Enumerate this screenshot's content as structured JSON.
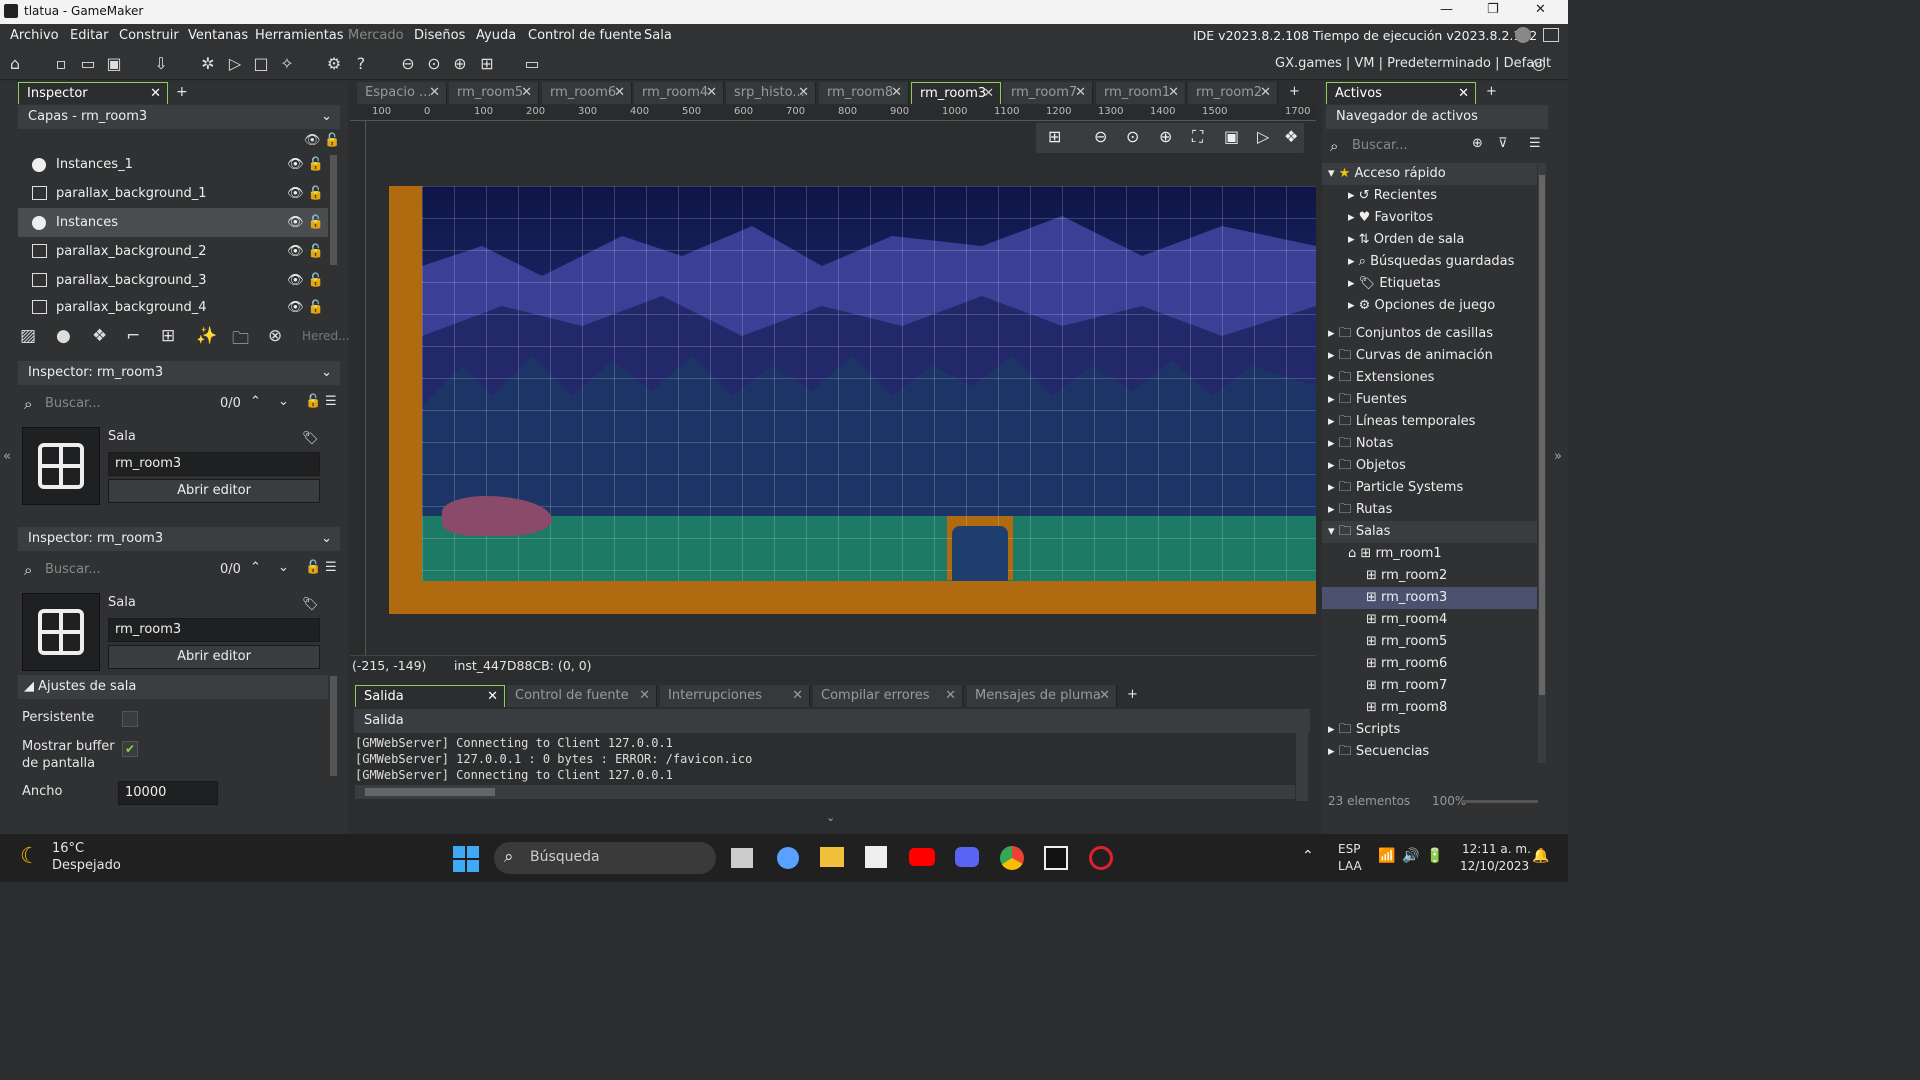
{
  "window": {
    "title": "tlatua - GameMaker",
    "minimize": "—",
    "maximize": "❐",
    "close": "✕"
  },
  "menu": [
    "Archivo",
    "Editar",
    "Construir",
    "Ventanas",
    "Herramientas",
    "Mercado",
    "Diseños",
    "Ayuda",
    "Control de fuente",
    "Sala"
  ],
  "ide_version": "IDE v2023.8.2.108 Tiempo de ejecución v2023.8.2.152",
  "target": "GX.games | VM | Predeterminado | Default",
  "left": {
    "tab": "Inspector",
    "layers_header": "Capas - rm_room3",
    "layers": [
      "Instances_1",
      "parallax_background_1",
      "Instances",
      "parallax_background_2",
      "parallax_background_3",
      "parallax_background_4"
    ],
    "selected_layer": "Instances",
    "inherit_placeholder": "Hered...",
    "inspector1": {
      "header": "Inspector: rm_room3",
      "search": "Buscar...",
      "count": "0/0",
      "kind": "Sala",
      "name": "rm_room3",
      "open": "Abrir editor"
    },
    "inspector2": {
      "header": "Inspector: rm_room3",
      "search": "Buscar...",
      "count": "0/0",
      "kind": "Sala",
      "name": "rm_room3",
      "open": "Abrir editor"
    },
    "room_settings": "Ajustes de sala",
    "persistent": "Persistente",
    "show_buffer": "Mostrar buffer de pantalla",
    "width_label": "Ancho",
    "width_value": "10000"
  },
  "doc_tabs": [
    "Espacio ...",
    "rm_room5",
    "rm_room6",
    "rm_room4",
    "srp_histo...",
    "rm_room8",
    "rm_room3",
    "rm_room7",
    "rm_room1",
    "rm_room2"
  ],
  "active_doc": "rm_room3",
  "ruler": [
    "100",
    "0",
    "100",
    "200",
    "300",
    "400",
    "500",
    "600",
    "700",
    "800",
    "900",
    "1000",
    "1100",
    "1200",
    "1300",
    "1400",
    "1500",
    "1700"
  ],
  "status": {
    "coords": "(-215, -149)",
    "instance": "inst_447D88CB: (0, 0)"
  },
  "output": {
    "tabs": [
      "Salida",
      "Control de fuente",
      "Interrupciones",
      "Compilar errores",
      "Mensajes de pluma"
    ],
    "header": "Salida",
    "lines": [
      "[GMWebServer] Connecting to Client 127.0.0.1",
      "[GMWebServer] 127.0.0.1 : 0 bytes : ERROR: /favicon.ico",
      "[GMWebServer] Connecting to Client 127.0.0.1"
    ]
  },
  "assets": {
    "tab": "Activos",
    "header": "Navegador de activos",
    "search": "Buscar...",
    "quick": "Acceso rápido",
    "quick_items": [
      "Recientes",
      "Favoritos",
      "Orden de sala",
      "Búsquedas guardadas",
      "Etiquetas",
      "Opciones de juego"
    ],
    "groups": [
      "Conjuntos de casillas",
      "Curvas de animación",
      "Extensiones",
      "Fuentes",
      "Líneas temporales",
      "Notas",
      "Objetos",
      "Particle Systems",
      "Rutas",
      "Salas"
    ],
    "rooms": [
      "rm_room1",
      "rm_room2",
      "rm_room3",
      "rm_room4",
      "rm_room5",
      "rm_room6",
      "rm_room7",
      "rm_room8"
    ],
    "after": [
      "Scripts",
      "Secuencias"
    ],
    "count": "23 elementos",
    "zoom": "100%"
  },
  "taskbar": {
    "temp": "16°C",
    "weather": "Despejado",
    "search": "Búsqueda",
    "lang1": "ESP",
    "lang2": "LAA",
    "time": "12:11 a. m.",
    "date": "12/10/2023"
  }
}
